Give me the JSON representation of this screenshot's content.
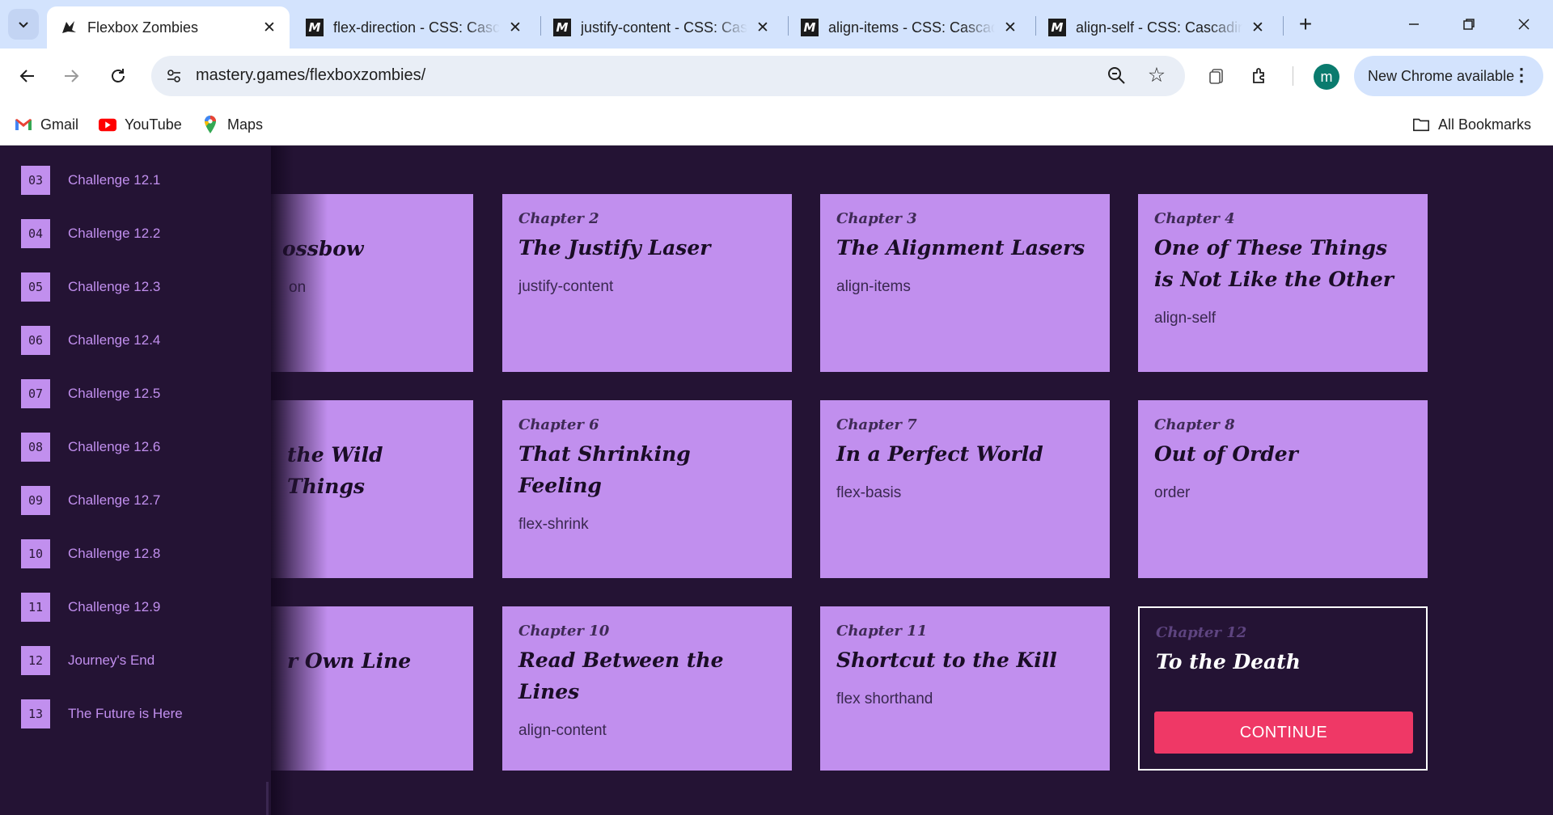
{
  "browser": {
    "tabs": [
      {
        "title": "Flexbox Zombies",
        "active": true
      },
      {
        "title": "flex-direction - CSS: Cascading Style Sheets | MDN",
        "active": false
      },
      {
        "title": "justify-content - CSS: Cascading Style Sheets | MDN",
        "active": false
      },
      {
        "title": "align-items - CSS: Cascading Style Sheets | MDN",
        "active": false
      },
      {
        "title": "align-self - CSS: Cascading Style Sheets | MDN",
        "active": false
      }
    ],
    "url": "mastery.games/flexboxzombies/",
    "profile_initial": "m",
    "update_label": "New Chrome available",
    "bookmarks": [
      {
        "label": "Gmail",
        "icon": "gmail-icon"
      },
      {
        "label": "YouTube",
        "icon": "youtube-icon"
      },
      {
        "label": "Maps",
        "icon": "maps-icon"
      }
    ],
    "all_bookmarks": "All Bookmarks"
  },
  "chapters": [
    {
      "chapter": "",
      "title": "ossbow",
      "prop": "on"
    },
    {
      "chapter": "Chapter 2",
      "title": "The Justify Laser",
      "prop": "justify-content"
    },
    {
      "chapter": "Chapter 3",
      "title": "The Alignment Lasers",
      "prop": "align-items"
    },
    {
      "chapter": "Chapter 4",
      "title": "One of These Things is Not Like the Other",
      "prop": "align-self"
    },
    {
      "chapter": "",
      "title": "the Wild Things",
      "prop": ""
    },
    {
      "chapter": "Chapter 6",
      "title": "That Shrinking Feeling",
      "prop": "flex-shrink"
    },
    {
      "chapter": "Chapter 7",
      "title": "In a Perfect World",
      "prop": "flex-basis"
    },
    {
      "chapter": "Chapter 8",
      "title": "Out of Order",
      "prop": "order"
    },
    {
      "chapter": "",
      "title": "r Own Line",
      "prop": ""
    },
    {
      "chapter": "Chapter 10",
      "title": "Read Between the Lines",
      "prop": "align-content"
    },
    {
      "chapter": "Chapter 11",
      "title": "Shortcut to the Kill",
      "prop": "flex shorthand"
    },
    {
      "chapter": "Chapter 12",
      "title": "To the Death",
      "prop": ""
    }
  ],
  "continue_label": "CONTINUE",
  "sidebar": {
    "items": [
      {
        "num": "03",
        "label": "Challenge 12.1"
      },
      {
        "num": "04",
        "label": "Challenge 12.2"
      },
      {
        "num": "05",
        "label": "Challenge 12.3"
      },
      {
        "num": "06",
        "label": "Challenge 12.4"
      },
      {
        "num": "07",
        "label": "Challenge 12.5"
      },
      {
        "num": "08",
        "label": "Challenge 12.6"
      },
      {
        "num": "09",
        "label": "Challenge 12.7"
      },
      {
        "num": "10",
        "label": "Challenge 12.8"
      },
      {
        "num": "11",
        "label": "Challenge 12.9"
      },
      {
        "num": "12",
        "label": "Journey's End"
      },
      {
        "num": "13",
        "label": "The Future is Here"
      }
    ]
  },
  "colors": {
    "page_bg": "#241334",
    "card_bg": "#c18fee",
    "accent_button": "#ef3866",
    "tabbar_bg": "#d3e3fd"
  }
}
